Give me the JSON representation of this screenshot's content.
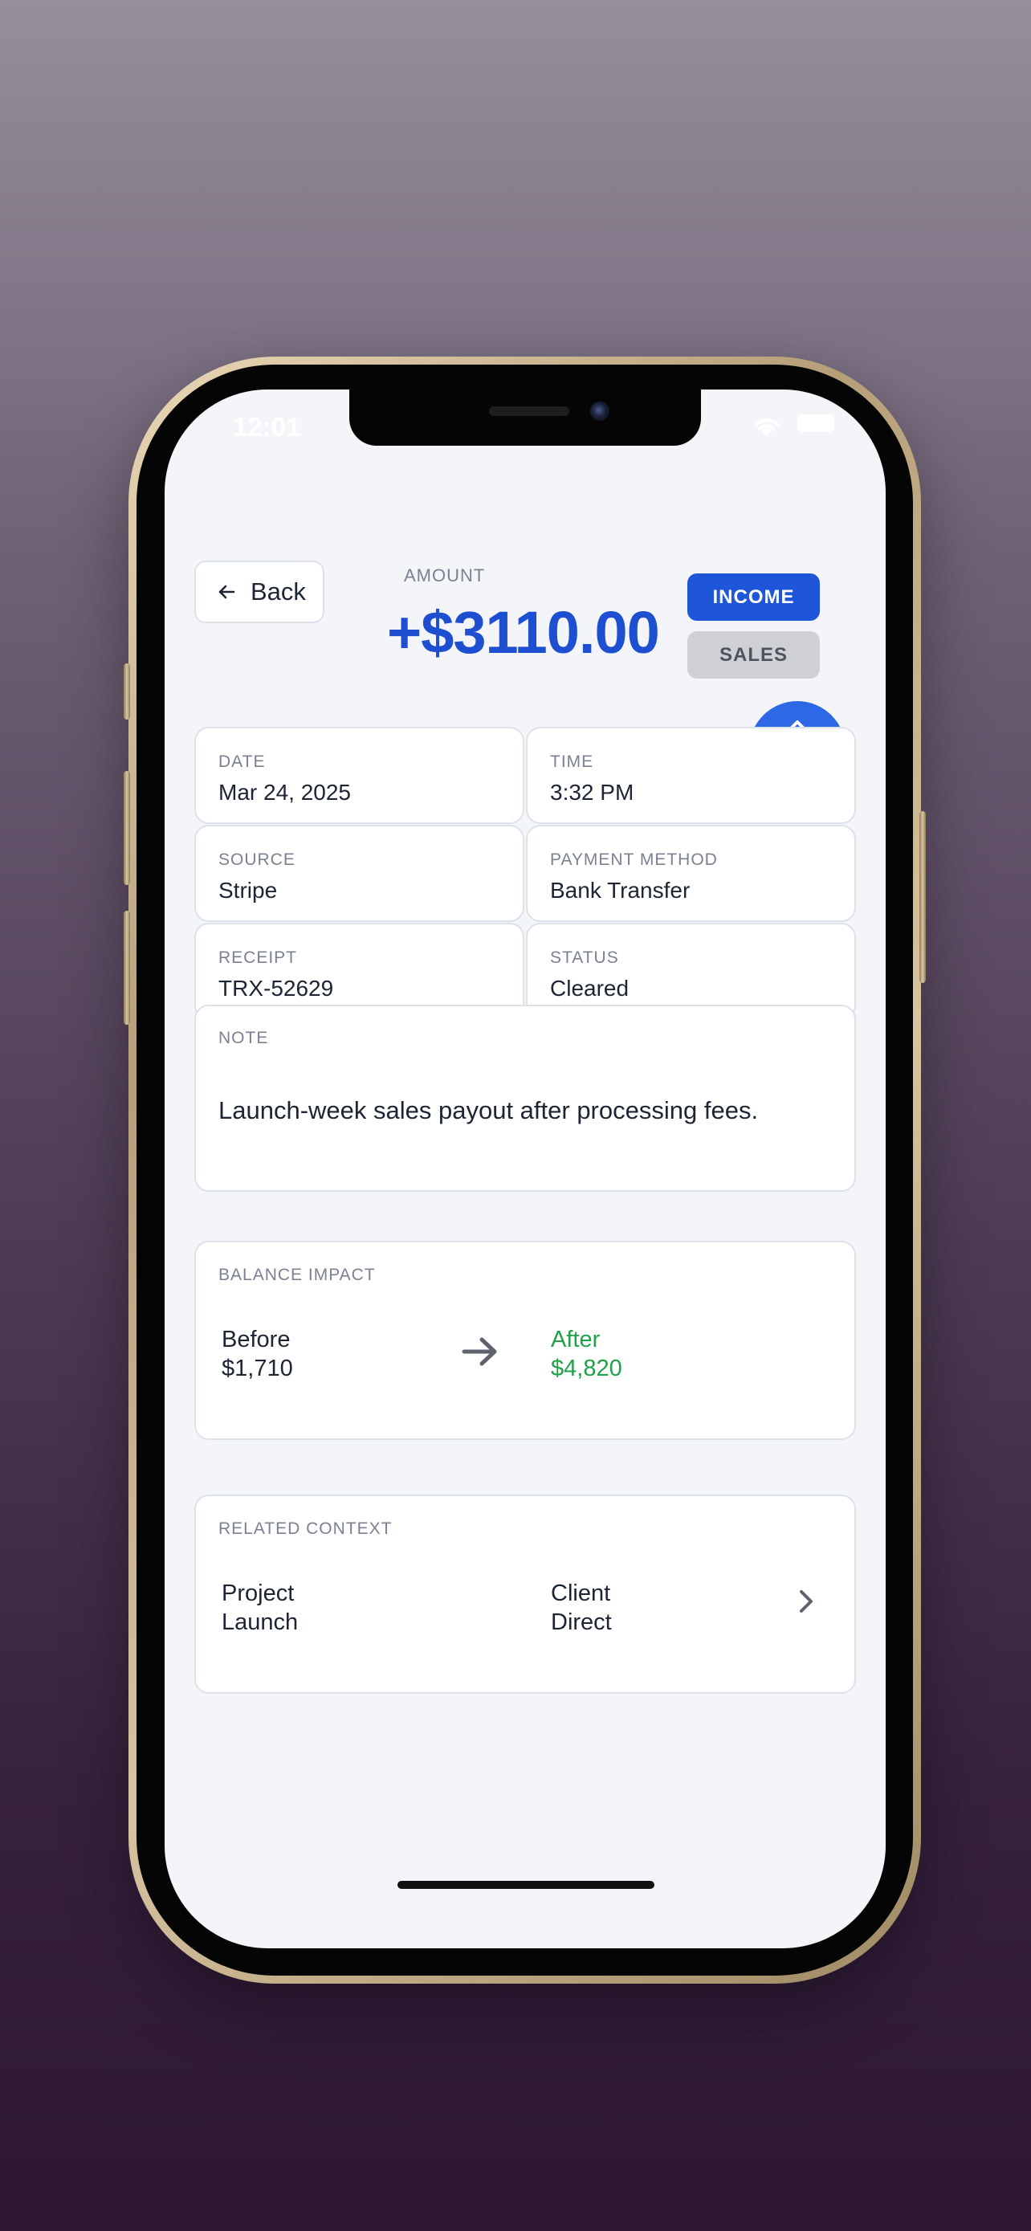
{
  "status_bar": {
    "time": "12:01",
    "wifi_icon": "wifi-icon",
    "battery_icon": "battery-icon"
  },
  "header": {
    "back_label": "Back",
    "back_icon": "arrow-left-icon",
    "amount_label": "AMOUNT",
    "amount_value": "+$3110.00",
    "amount_color": "#1f4fd1"
  },
  "chips": {
    "income_label": "INCOME",
    "sales_label": "SALES"
  },
  "fab": {
    "icon": "chevron-up-icon",
    "color": "#2d68e6"
  },
  "details": {
    "date_label": "DATE",
    "date_value": "Mar 24, 2025",
    "time_label": "TIME",
    "time_value": "3:32 PM",
    "source_label": "SOURCE",
    "source_value": "Stripe",
    "payment_label": "PAYMENT METHOD",
    "payment_value": "Bank Transfer",
    "receipt_label": "RECEIPT",
    "receipt_value": "TRX-52629",
    "status_label": "STATUS",
    "status_value": "Cleared"
  },
  "note": {
    "label": "NOTE",
    "text": "Launch-week sales payout after processing fees."
  },
  "balance_impact": {
    "label": "BALANCE IMPACT",
    "before_label": "Before",
    "before_value": "$1,710",
    "after_label": "After",
    "after_value": "$4,820",
    "after_color": "#21a04a",
    "arrow_icon": "arrow-right-icon"
  },
  "related_context": {
    "label": "RELATED CONTEXT",
    "project_label": "Project",
    "project_value": "Launch",
    "client_label": "Client",
    "client_value": "Direct",
    "chevron_icon": "chevron-right-icon"
  }
}
